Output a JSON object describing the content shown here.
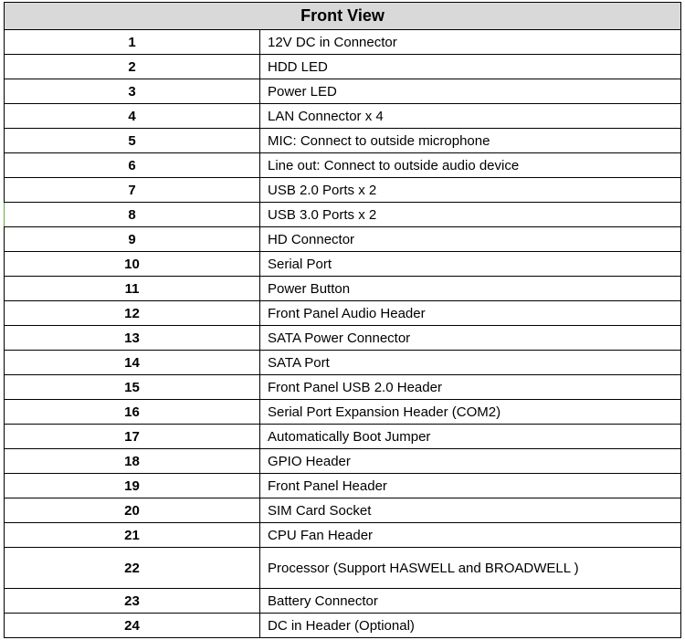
{
  "title": "Front View",
  "rows": [
    {
      "num": "1",
      "desc": "12V DC in Connector"
    },
    {
      "num": "2",
      "desc": "HDD LED"
    },
    {
      "num": "3",
      "desc": "Power LED"
    },
    {
      "num": "4",
      "desc": "LAN Connector x 4"
    },
    {
      "num": "5",
      "desc": "MIC: Connect to outside microphone"
    },
    {
      "num": "6",
      "desc": "Line out: Connect to outside audio device"
    },
    {
      "num": "7",
      "desc": "USB 2.0 Ports x 2"
    },
    {
      "num": "8",
      "desc": "USB 3.0 Ports x 2"
    },
    {
      "num": "9",
      "desc": "HD Connector"
    },
    {
      "num": "10",
      "desc": "Serial Port"
    },
    {
      "num": "11",
      "desc": "Power Button"
    },
    {
      "num": "12",
      "desc": "Front Panel Audio Header"
    },
    {
      "num": "13",
      "desc": "SATA Power Connector"
    },
    {
      "num": "14",
      "desc": "SATA Port"
    },
    {
      "num": "15",
      "desc": "Front Panel USB 2.0 Header"
    },
    {
      "num": "16",
      "desc": "Serial Port Expansion Header (COM2)"
    },
    {
      "num": "17",
      "desc": "Automatically Boot Jumper"
    },
    {
      "num": "18",
      "desc": "GPIO Header"
    },
    {
      "num": "19",
      "desc": "Front Panel Header"
    },
    {
      "num": "20",
      "desc": "SIM Card Socket"
    },
    {
      "num": "21",
      "desc": "CPU Fan Header"
    },
    {
      "num": "22",
      "desc": "Processor (Support HASWELL and BROADWELL )"
    },
    {
      "num": "23",
      "desc": "Battery Connector"
    },
    {
      "num": "24",
      "desc": "DC in Header (Optional)"
    }
  ]
}
